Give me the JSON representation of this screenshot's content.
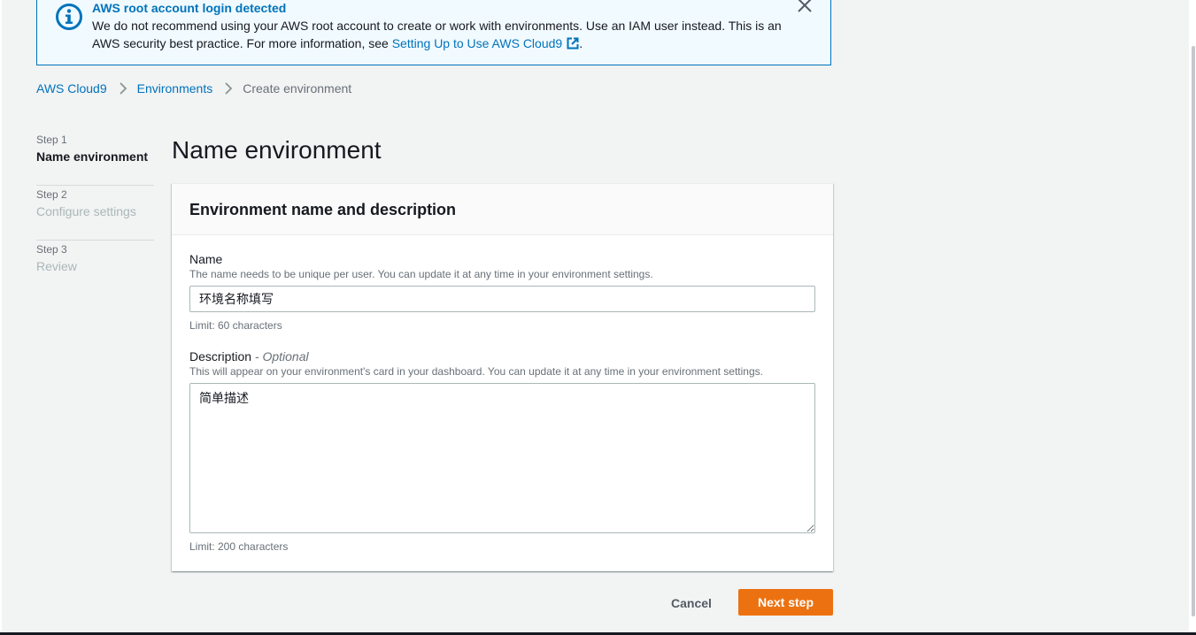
{
  "flash": {
    "title": "AWS root account login detected",
    "message": "We do not recommend using your AWS root account to create or work with environments. Use an IAM user instead. This is an AWS security best practice. For more information, see ",
    "link_text": "Setting Up to Use AWS Cloud9",
    "message_end": ".",
    "type": "info",
    "accent_color": "#0073bb"
  },
  "breadcrumb": {
    "items": [
      "AWS Cloud9",
      "Environments"
    ],
    "current": "Create environment"
  },
  "steps": [
    {
      "number": "Step 1",
      "title": "Name environment",
      "active": true
    },
    {
      "number": "Step 2",
      "title": "Configure settings",
      "active": false
    },
    {
      "number": "Step 3",
      "title": "Review",
      "active": false
    }
  ],
  "page": {
    "title": "Name environment"
  },
  "container": {
    "title": "Environment name and description"
  },
  "name_field": {
    "label": "Name",
    "description": "The name needs to be unique per user. You can update it at any time in your environment settings.",
    "value": "环境名称填写",
    "constraint": "Limit: 60 characters"
  },
  "description_field": {
    "label": "Description",
    "optional": " - Optional",
    "description": "This will appear on your environment's card in your dashboard. You can update it at any time in your environment settings.",
    "value": "简单描述",
    "constraint": "Limit: 200 characters"
  },
  "actions": {
    "cancel_label": "Cancel",
    "next_label": "Next step",
    "primary_color": "#ec7211"
  }
}
